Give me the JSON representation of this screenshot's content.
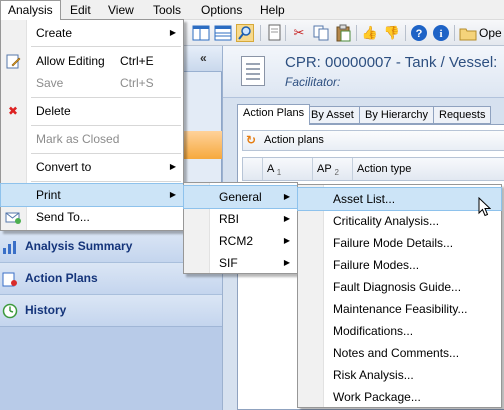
{
  "menubar": {
    "items": [
      "Analysis",
      "Edit",
      "View",
      "Tools",
      "Options",
      "Help"
    ]
  },
  "toolbar": {
    "open_label": "Ope"
  },
  "left_pane": {
    "sections": [
      {
        "label": "Analysis Summary",
        "icon": "analysis-summary-icon"
      },
      {
        "label": "Action Plans",
        "icon": "action-plans-icon"
      },
      {
        "label": "History",
        "icon": "history-icon"
      }
    ]
  },
  "content": {
    "title": "CPR: 00000007 - Tank / Vessel:",
    "subtitle": "Facilitator:",
    "tabs": [
      "Action Plans",
      "By Asset",
      "By Hierarchy",
      "Requests"
    ],
    "action_plans_header": "Action plans",
    "grid_columns": [
      {
        "label": "A",
        "sort": "1"
      },
      {
        "label": "AP",
        "sort": "2"
      },
      {
        "label": "Action type",
        "sort": ""
      }
    ]
  },
  "analysis_menu": {
    "items": [
      {
        "label": "Create",
        "shortcut": "",
        "has_submenu": true,
        "disabled": false,
        "icon": ""
      },
      {
        "label": "Allow Editing",
        "shortcut": "Ctrl+E",
        "has_submenu": false,
        "disabled": false,
        "icon": "allow-editing-icon"
      },
      {
        "label": "Save",
        "shortcut": "Ctrl+S",
        "has_submenu": false,
        "disabled": true,
        "icon": ""
      },
      {
        "label": "Delete",
        "shortcut": "",
        "has_submenu": false,
        "disabled": false,
        "icon": "delete-icon"
      },
      {
        "label": "Mark as Closed",
        "shortcut": "",
        "has_submenu": false,
        "disabled": true,
        "icon": ""
      },
      {
        "label": "Convert to",
        "shortcut": "",
        "has_submenu": true,
        "disabled": false,
        "icon": ""
      },
      {
        "label": "Print",
        "shortcut": "",
        "has_submenu": true,
        "disabled": false,
        "icon": ""
      },
      {
        "label": "Send To...",
        "shortcut": "",
        "has_submenu": false,
        "disabled": false,
        "icon": "send-to-icon"
      }
    ]
  },
  "print_submenu": {
    "items": [
      "General",
      "RBI",
      "RCM2",
      "SIF"
    ]
  },
  "general_submenu": {
    "items": [
      "Asset List...",
      "Criticality Analysis...",
      "Failure Mode Details...",
      "Failure Modes...",
      "Fault Diagnosis Guide...",
      "Maintenance Feasibility...",
      "Modifications...",
      "Notes and Comments...",
      "Risk Analysis...",
      "Work Package..."
    ]
  },
  "colors": {
    "menu_highlight": "#cce4f7",
    "left_pane_bg": "#e3ebf6",
    "section_label": "#14347a",
    "title_blue": "#2d4f80"
  }
}
